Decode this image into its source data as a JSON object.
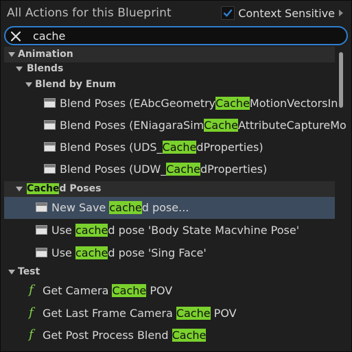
{
  "header": {
    "title": "All Actions for this Blueprint",
    "context_label": "Context Sensitive",
    "context_checked": true,
    "accent_color": "#2f7fcf"
  },
  "search": {
    "value": "cache",
    "clear_icon": "close-icon"
  },
  "tree": {
    "animation": "Animation",
    "blends": "Blends",
    "blend_by_enum": "Blend by Enum",
    "blend_items": [
      {
        "pre": "Blend Poses (EAbcGeometry",
        "hl": "Cache",
        "post": "MotionVectorsIn"
      },
      {
        "pre": "Blend Poses (ENiagaraSim",
        "hl": "Cache",
        "post": "AttributeCaptureMo"
      },
      {
        "pre": "Blend Poses (UDS_",
        "hl": "Cache",
        "post": "dProperties)"
      },
      {
        "pre": "Blend Poses (UDW_",
        "hl": "Cache",
        "post": "dProperties)"
      }
    ],
    "cached_poses": {
      "hl": "Cache",
      "post": "d Poses"
    },
    "cached_items": [
      {
        "pre": "New Save ",
        "hl": "cache",
        "post": "d pose...",
        "selected": true
      },
      {
        "pre": "Use ",
        "hl": "cache",
        "post": "d pose 'Body State Macvhine Pose'"
      },
      {
        "pre": "Use ",
        "hl": "cache",
        "post": "d pose 'Sing Face'"
      }
    ],
    "test": "Test",
    "func_symbol": "f",
    "test_items": [
      {
        "pre": "Get Camera ",
        "hl": "Cache",
        "post": " POV"
      },
      {
        "pre": "Get Last Frame Camera ",
        "hl": "Cache",
        "post": " POV"
      },
      {
        "pre": "Get Post Process Blend ",
        "hl": "Cache",
        "post": ""
      }
    ],
    "highlight_color": "#7ad12d",
    "selected_color": "#3c4b5e"
  }
}
